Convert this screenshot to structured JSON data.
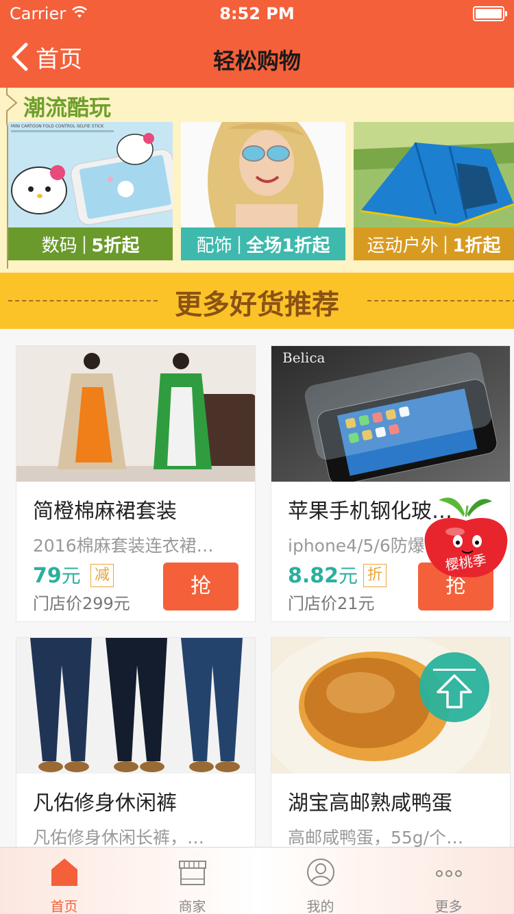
{
  "status_bar": {
    "carrier": "Carrier",
    "time": "8:52 PM"
  },
  "nav": {
    "back_label": "首页",
    "title": "轻松购物"
  },
  "promo": {
    "heading": "潮流酷玩",
    "cards": [
      {
        "category": "数码",
        "discount": "5折起",
        "label_color": "#6b9a2c"
      },
      {
        "category": "配饰",
        "discount": "全场1折起",
        "label_color": "#3fb9ad"
      },
      {
        "category": "运动户外",
        "discount": "1折起",
        "label_color": "#d89b22"
      }
    ],
    "card_image_texts": [
      "MINI CARTOON FOLD CONTROL SELFIE STICK"
    ]
  },
  "recommend": {
    "title": "更多好货推荐"
  },
  "products": [
    {
      "title": "简橙棉麻裙套装",
      "desc": "2016棉麻套装连衣裙…",
      "price": "79",
      "unit": "元",
      "tag": "减",
      "orig": "门店价299元",
      "button": "抢"
    },
    {
      "title": "苹果手机钢化玻…",
      "desc": "iphone4/5/6防爆…",
      "price": "8.82",
      "unit": "元",
      "tag": "折",
      "orig": "门店价21元",
      "button": "抢",
      "image_brand": "Belica"
    },
    {
      "title": "凡佑修身休闲裤",
      "desc": "凡佑修身休闲长裤，…"
    },
    {
      "title": "湖宝高邮熟咸鸭蛋",
      "desc": "高邮咸鸭蛋，55g/个…"
    }
  ],
  "floating": {
    "cherry_text": "樱桃季"
  },
  "tabs": [
    {
      "label": "首页",
      "icon": "home-icon",
      "active": true
    },
    {
      "label": "商家",
      "icon": "store-icon",
      "active": false
    },
    {
      "label": "我的",
      "icon": "user-icon",
      "active": false
    },
    {
      "label": "更多",
      "icon": "more-icon",
      "active": false
    }
  ],
  "colors": {
    "primary": "#f4603a",
    "accent_teal": "#29b09e",
    "banner_yellow": "#fcc329"
  }
}
